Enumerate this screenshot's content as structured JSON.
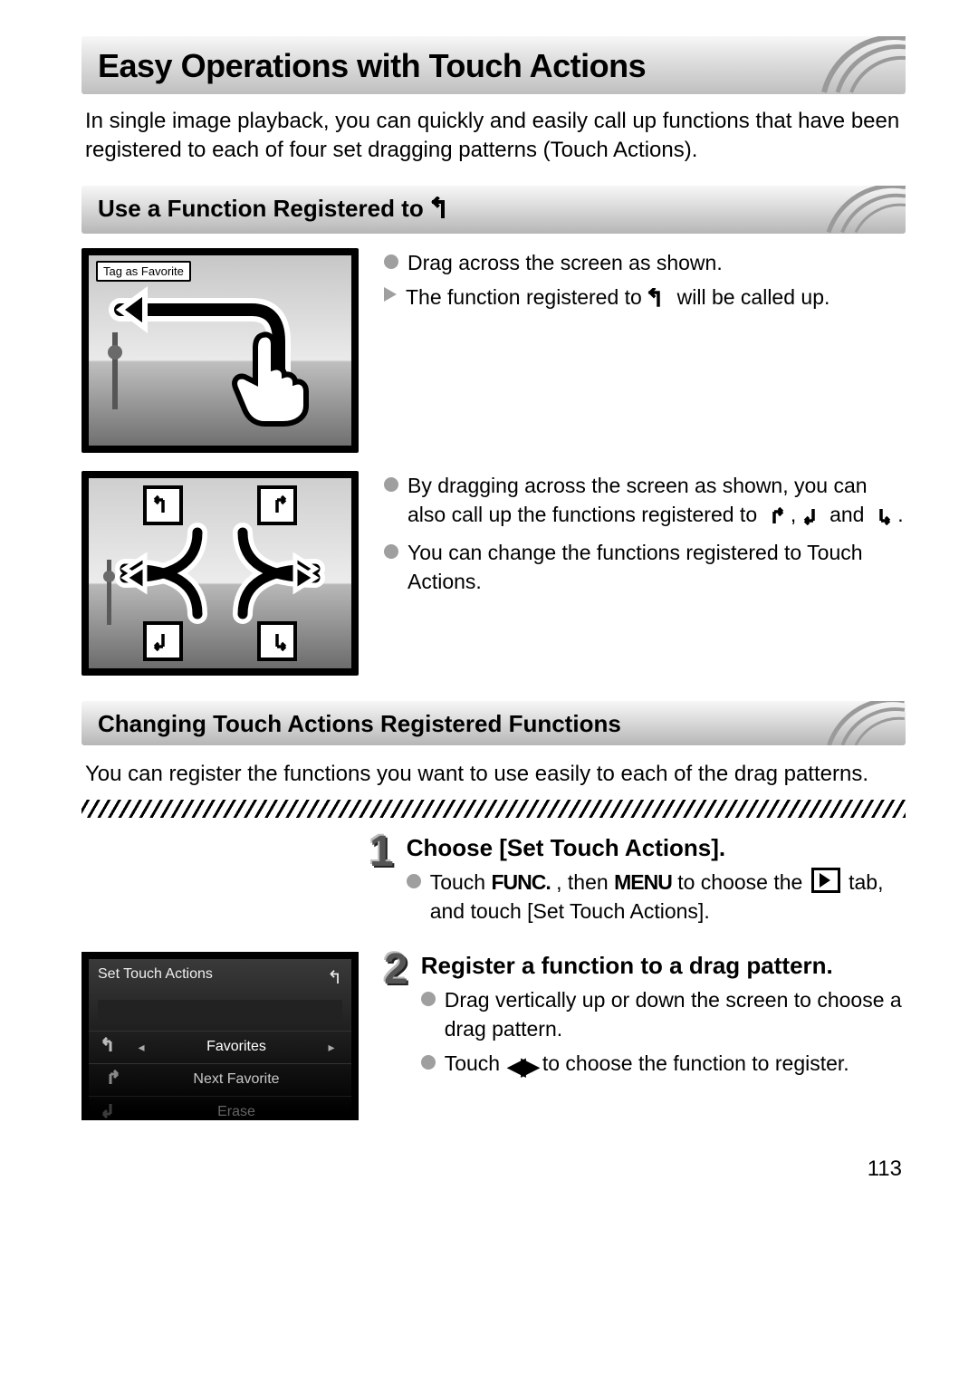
{
  "page_number": "113",
  "title": "Easy Operations with Touch Actions",
  "lead": "In single image playback, you can quickly and easily call up functions that have been registered to each of four set dragging patterns (Touch Actions).",
  "section_use": {
    "title_prefix": "Use a Function Registered to ",
    "bullets_a": [
      "Drag across the screen as shown.",
      "The function registered to "
    ],
    "bullets_a_tail": " will be called up.",
    "bullets_b_pre": "By dragging across the screen as shown, you can also call up the functions registered to ",
    "bullets_b_mid1": " , ",
    "bullets_b_mid2": " and ",
    "bullets_b_tail": " .",
    "bullets_b2": "You can change the functions registered to Touch Actions."
  },
  "thumb1": {
    "tag_label": "Tag as Favorite"
  },
  "section_change": {
    "title": "Changing Touch Actions Registered Functions",
    "lead": "You can register the functions you want to use easily to each of the drag patterns."
  },
  "steps": [
    {
      "num": "1",
      "title": "Choose [Set Touch Actions].",
      "b1_pre": "Touch ",
      "b1_func": "FUNC.",
      "b1_mid": ", then ",
      "b1_menu": "MENU",
      "b1_post": " to choose the ",
      "b1_tail": " tab, and touch [Set Touch Actions]."
    },
    {
      "num": "2",
      "title": "Register a function to a drag pattern.",
      "b1": "Drag vertically up or down the screen to choose a drag pattern.",
      "b2_pre": "Touch ",
      "b2_post": " to choose the function to register."
    }
  ],
  "settings_thumb": {
    "header": "Set Touch Actions",
    "rows": [
      "Favorites",
      "Next Favorite",
      "Erase"
    ]
  }
}
